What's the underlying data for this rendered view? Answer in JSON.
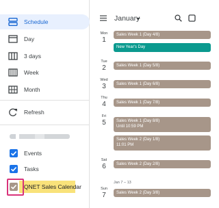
{
  "drawer": {
    "items": [
      {
        "label": "Schedule",
        "icon": "schedule-icon",
        "active": true
      },
      {
        "label": "Day",
        "icon": "day-icon"
      },
      {
        "label": "3 days",
        "icon": "three-days-icon"
      },
      {
        "label": "Week",
        "icon": "week-icon"
      },
      {
        "label": "Month",
        "icon": "month-icon"
      }
    ],
    "refresh_label": "Refresh",
    "calendars": [
      {
        "label": "Events",
        "checked": true,
        "color": "#1a73e8"
      },
      {
        "label": "Tasks",
        "checked": true,
        "color": "#1a73e8"
      },
      {
        "label": "QNET Sales Calendar",
        "checked": true,
        "color": "#a79689"
      }
    ]
  },
  "header": {
    "month": "January",
    "menu_icon": "menu-icon",
    "search_icon": "search-icon",
    "view_icon": "square-icon"
  },
  "colors": {
    "accent": "#1a73e8",
    "event_gray": "#a79689",
    "holiday_green": "#0b9a8f",
    "highlight": "#f9e27a"
  },
  "schedule": {
    "days": [
      {
        "dow": "Mon",
        "date": "1"
      },
      {
        "dow": "Tue",
        "date": "2"
      },
      {
        "dow": "Wed",
        "date": "3"
      },
      {
        "dow": "Thu",
        "date": "4"
      },
      {
        "dow": "Fri",
        "date": "5"
      },
      {
        "dow": "Sat",
        "date": "6"
      },
      {
        "dow": "Sun",
        "date": "7"
      }
    ],
    "events": [
      {
        "title": "Sales Week 1 (Day 4/8)",
        "color": "gray"
      },
      {
        "title": "New Year's Day",
        "color": "green"
      },
      {
        "title": "Sales Week 1 (Day 5/8)",
        "color": "gray"
      },
      {
        "title": "Sales Week 1 (Day 6/8)",
        "color": "gray"
      },
      {
        "title": "Sales Week 1 (Day 7/8)",
        "color": "gray"
      },
      {
        "title": "Sales Week 1 (Day 8/8)",
        "sub": "Until 10:59 PM",
        "color": "gray"
      },
      {
        "title": "Sales Week 2 (Day 1/8)",
        "sub": "11:01 PM",
        "color": "gray"
      },
      {
        "title": "Sales Week 2 (Day 2/8)",
        "color": "gray"
      },
      {
        "title": "Sales Week 2 (Day 3/8)",
        "color": "gray"
      }
    ],
    "week_range": "Jan 7 – 13"
  }
}
